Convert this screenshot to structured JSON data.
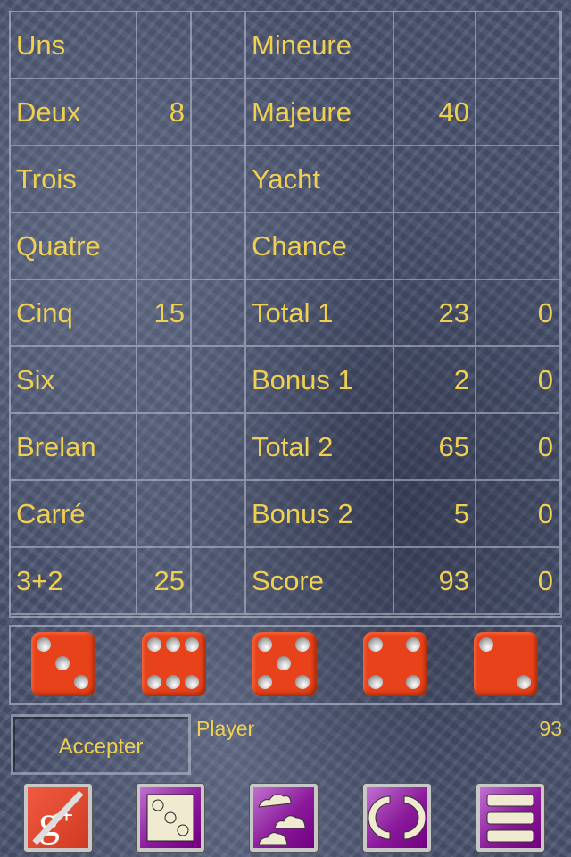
{
  "scorecard": {
    "rows": [
      {
        "left_label": "Uns",
        "left_value": "",
        "right_label": "Mineure",
        "right_value": "",
        "right_value2": ""
      },
      {
        "left_label": "Deux",
        "left_value": "8",
        "right_label": "Majeure",
        "right_value": "40",
        "right_value2": ""
      },
      {
        "left_label": "Trois",
        "left_value": "",
        "right_label": "Yacht",
        "right_value": "",
        "right_value2": ""
      },
      {
        "left_label": "Quatre",
        "left_value": "",
        "right_label": "Chance",
        "right_value": "",
        "right_value2": ""
      },
      {
        "left_label": "Cinq",
        "left_value": "15",
        "right_label": "Total 1",
        "right_value": "23",
        "right_value2": "0"
      },
      {
        "left_label": "Six",
        "left_value": "",
        "right_label": "Bonus 1",
        "right_value": "2",
        "right_value2": "0"
      },
      {
        "left_label": "Brelan",
        "left_value": "",
        "right_label": "Total 2",
        "right_value": "65",
        "right_value2": "0"
      },
      {
        "left_label": "Carré",
        "left_value": "",
        "right_label": "Bonus 2",
        "right_value": "5",
        "right_value2": "0"
      },
      {
        "left_label": "3+2",
        "left_value": "25",
        "right_label": "Score",
        "right_value": "93",
        "right_value2": "0"
      }
    ]
  },
  "dice": [
    3,
    6,
    5,
    4,
    2
  ],
  "colors": {
    "text": "#f0d050",
    "die": "#e8421a",
    "button": "#8a1a9a"
  },
  "accept_label": "Accepter",
  "player": {
    "name": "Player",
    "score": "93"
  },
  "toolbar": [
    {
      "icon": "google-plus-disabled-icon"
    },
    {
      "icon": "dice-icon"
    },
    {
      "icon": "clouds-icon"
    },
    {
      "icon": "refresh-icon"
    },
    {
      "icon": "menu-icon"
    }
  ]
}
